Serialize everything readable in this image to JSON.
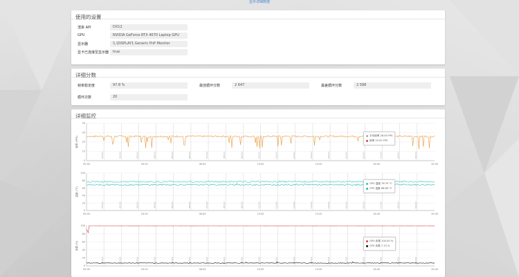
{
  "top_link": "显示详细数据",
  "settings": {
    "title": "使用的设置",
    "rows": [
      {
        "label": "渲染 API",
        "value": "DX12"
      },
      {
        "label": "GPU",
        "value": "NVIDIA GeForce RTX 4070 Laptop GPU"
      },
      {
        "label": "显示器",
        "value": "\\\\.\\DISPLAY1 Generic PnP Monitor"
      },
      {
        "label": "显卡已连接至显示器",
        "value": "true"
      }
    ]
  },
  "scores": {
    "title": "详细分数",
    "frame_stability_label": "帧率稳定度",
    "frame_stability_value": "97.8 %",
    "best_loop_label": "最佳循环分数",
    "best_loop_value": "2 647",
    "worst_loop_label": "最差循环分数",
    "worst_loop_value": "2 588",
    "loop_count_label": "循环次数",
    "loop_count_value": "20"
  },
  "monitor": {
    "title": "详细监控"
  },
  "colors": {
    "fps": "#e8983a",
    "temp_gpu": "#2ec7c0",
    "temp_cpu": "#29b5b0",
    "load_gpu": "#d9424a",
    "load_cpu": "#111111",
    "marker": "#aaaaaa",
    "link": "#4a8ad0"
  },
  "chart_data": [
    {
      "type": "line",
      "ylabel": "帧率 (FPS)",
      "ylim": [
        0,
        40
      ],
      "yticks": [
        "0",
        "10",
        "20",
        "30",
        "40"
      ],
      "xticks": [
        "00:00",
        "03:20",
        "06:40",
        "10:00",
        "13:20",
        "16:40",
        "20:00"
      ],
      "xlim": [
        0,
        1200
      ],
      "markers": [
        "01:00.0",
        "02:00.0",
        "03:00.0",
        "04:00.0",
        "05:00.0",
        "06:00.0",
        "07:00.0",
        "08:00.0",
        "09:00.0",
        "10:00.0",
        "11:00.0",
        "12:00.0",
        "13:00.0",
        "14:00.0",
        "15:00.0",
        "16:00.0",
        "17:00.0",
        "18:00.0",
        "19:00.0"
      ],
      "series": [
        {
          "name": "平均帧率",
          "value_label": "26.00 FPS",
          "mean": 26.0,
          "noise": 0.9,
          "dips": 34,
          "color_key": "fps"
        }
      ],
      "legend": [
        {
          "text": "平均帧率 26.00 FPS",
          "color_key": "marker"
        },
        {
          "text": "帧率 25.92 FPS",
          "color_key": "load_gpu"
        }
      ]
    },
    {
      "type": "line",
      "ylabel": "温度 (°C)",
      "ylim": [
        0,
        100
      ],
      "yticks": [
        "0",
        "20",
        "40",
        "60",
        "80",
        "100"
      ],
      "xticks": [
        "00:00",
        "03:20",
        "06:40",
        "10:00",
        "13:20",
        "16:40",
        "20:00"
      ],
      "xlim": [
        0,
        1200
      ],
      "markers": [
        "01:00.0",
        "02:00.0",
        "03:00.0",
        "04:00.0",
        "05:00.0",
        "06:00.0",
        "07:00.0",
        "08:00.0",
        "09:00.0",
        "10:00.0",
        "11:00.0",
        "12:00.0",
        "13:00.0",
        "14:00.0",
        "15:00.0",
        "16:00.0",
        "17:00.0",
        "18:00.0",
        "19:00.0"
      ],
      "series": [
        {
          "name": "GPU 温度",
          "mean": 76.8,
          "noise": 1.6,
          "color_key": "temp_gpu"
        },
        {
          "name": "CPU 温度",
          "mean": 68.9,
          "noise": 1.8,
          "color_key": "temp_cpu"
        }
      ],
      "legend": [
        {
          "text": "GPU 温度 76.79 °C",
          "color_key": "temp_gpu"
        },
        {
          "text": "CPU 温度 68.89 °C",
          "color_key": "temp_cpu"
        }
      ]
    },
    {
      "type": "line",
      "ylabel": "负载 (%)",
      "ylim": [
        0,
        100
      ],
      "yticks": [
        "0",
        "20",
        "40",
        "60",
        "80",
        "100"
      ],
      "xticks": [
        "00:00",
        "03:20",
        "06:40",
        "10:00",
        "13:20",
        "16:40",
        "20:00"
      ],
      "xlim": [
        0,
        1200
      ],
      "markers": [
        "01:00.0",
        "02:00.0",
        "03:00.0",
        "04:00.0",
        "05:00.0",
        "06:00.0",
        "07:00.0",
        "08:00.0",
        "09:00.0",
        "10:00.0",
        "11:00.0",
        "12:00.0",
        "13:00.0",
        "14:00.0",
        "15:00.0",
        "16:00.0",
        "17:00.0",
        "18:00.0",
        "19:00.0"
      ],
      "series": [
        {
          "name": "GPU 负载",
          "mean": 100.0,
          "noise": 0.2,
          "color_key": "load_gpu"
        },
        {
          "name": "CPU 负载",
          "mean": 7.1,
          "noise": 0.8,
          "color_key": "load_cpu"
        }
      ],
      "legend": [
        {
          "text": "GPU 负载 100.00 %",
          "color_key": "load_gpu"
        },
        {
          "text": "CPU 负载 7.13 %",
          "color_key": "load_cpu"
        }
      ]
    }
  ]
}
